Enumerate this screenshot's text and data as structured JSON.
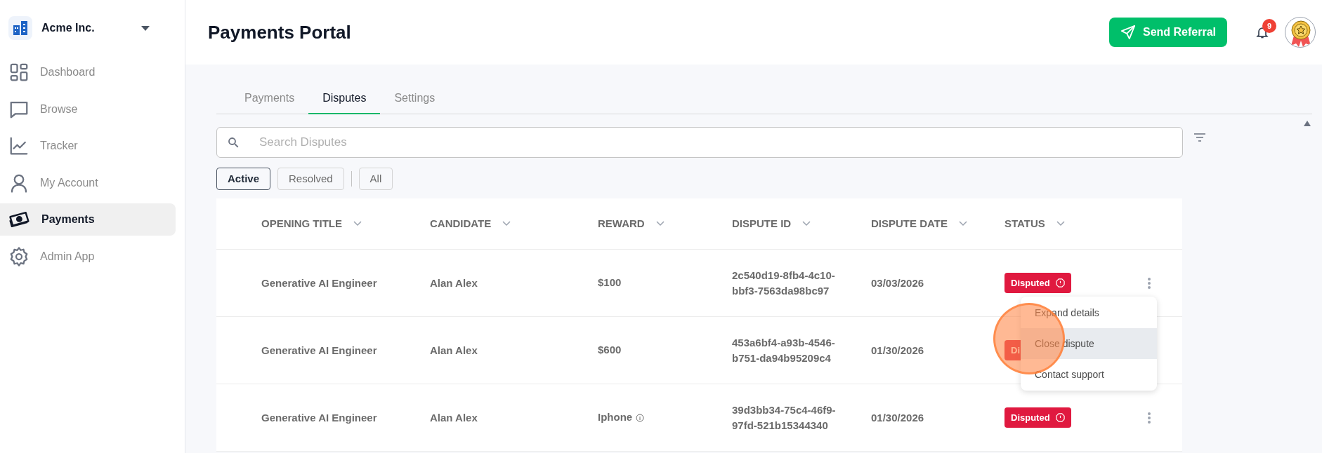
{
  "sidebar": {
    "org": "Acme Inc.",
    "items": [
      {
        "label": "Dashboard",
        "selected": false
      },
      {
        "label": "Browse",
        "selected": false
      },
      {
        "label": "Tracker",
        "selected": false
      },
      {
        "label": "My Account",
        "selected": false
      },
      {
        "label": "Payments",
        "selected": true
      },
      {
        "label": "Admin App",
        "selected": false
      }
    ]
  },
  "header": {
    "title": "Payments Portal",
    "action": "Send Referral",
    "notifications": "9"
  },
  "tabs": [
    {
      "label": "Payments",
      "selected": false
    },
    {
      "label": "Disputes",
      "selected": true
    },
    {
      "label": "Settings",
      "selected": false
    }
  ],
  "search": {
    "placeholder": "Search Disputes"
  },
  "filters": [
    {
      "label": "Active",
      "selected": true
    },
    {
      "label": "Resolved",
      "selected": false
    },
    {
      "label": "All",
      "selected": false
    }
  ],
  "table": {
    "columns": [
      "OPENING TITLE",
      "CANDIDATE",
      "REWARD",
      "DISPUTE ID",
      "DISPUTE DATE",
      "STATUS"
    ],
    "rows": [
      {
        "title": "Generative AI Engineer",
        "candidate": "Alan Alex",
        "reward": "$100",
        "reward_info": false,
        "dispute_id": "2c540d19-8fb4-4c10-bbf3-7563da98bc97",
        "date": "03/03/2026",
        "status": "Disputed",
        "menu": true
      },
      {
        "title": "Generative AI Engineer",
        "candidate": "Alan Alex",
        "reward": "$600",
        "reward_info": false,
        "dispute_id": "453a6bf4-a93b-4546-b751-da94b95209c4",
        "date": "01/30/2026",
        "status": "Di"
      },
      {
        "title": "Generative AI Engineer",
        "candidate": "Alan Alex",
        "reward": "Iphone",
        "reward_info": true,
        "dispute_id": "39d3bb34-75c4-46f9-97fd-521b15344340",
        "date": "01/30/2026",
        "status": "Disputed",
        "menu": true
      }
    ]
  },
  "context_menu": {
    "items": [
      {
        "label": "Expand details",
        "selected": false
      },
      {
        "label": "Close dispute",
        "selected": true
      },
      {
        "label": "Contact support",
        "selected": false
      }
    ]
  }
}
